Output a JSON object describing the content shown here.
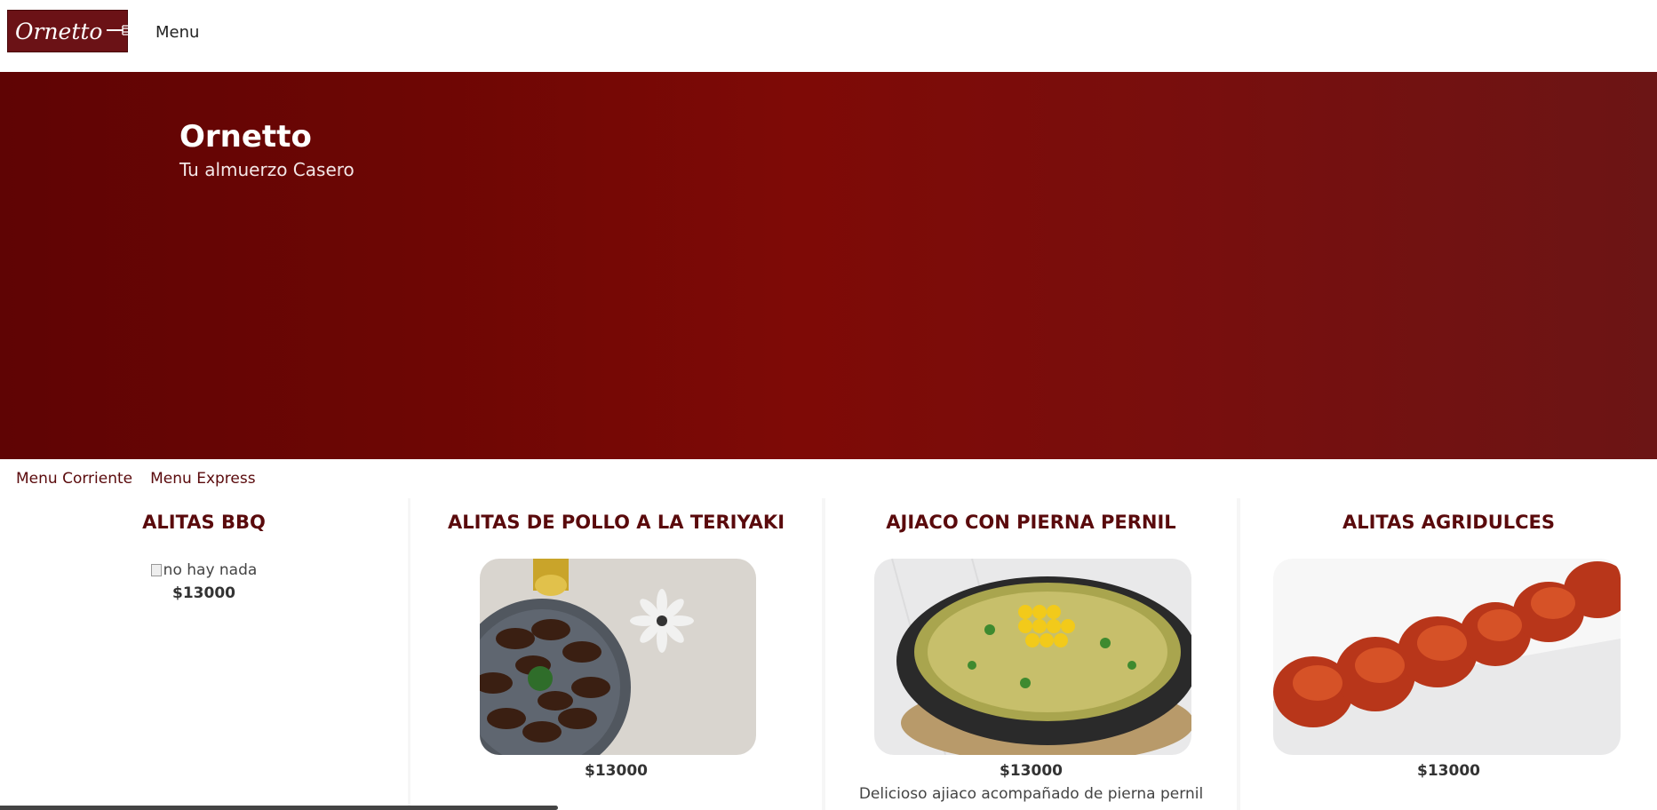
{
  "brand": {
    "logo_text": "Ornetto",
    "logo_color": "#6b1216"
  },
  "nav": {
    "menu_label": "Menu"
  },
  "hero": {
    "title": "Ornetto",
    "subtitle": "Tu almuerzo Casero"
  },
  "tabs": [
    {
      "label": "Menu Corriente"
    },
    {
      "label": "Menu Express"
    }
  ],
  "cards": [
    {
      "title": "ALITAS BBQ",
      "image_alt": "no hay nada",
      "price": "$13000",
      "description": ""
    },
    {
      "title": "ALITAS DE POLLO A LA TERIYAKI",
      "image": "teriyaki-wings-plate",
      "price": "$13000",
      "description": ""
    },
    {
      "title": "AJIACO CON PIERNA PERNIL",
      "image": "ajiaco-soup-bowl",
      "price": "$13000",
      "description": "Delicioso ajiaco acompañado de pierna pernil"
    },
    {
      "title": "ALITAS AGRIDULCES",
      "image": "sweet-sour-wings-plate",
      "price": "$13000",
      "description": ""
    }
  ],
  "colors": {
    "accent": "#5a0a0c",
    "hero_start": "#5f0404",
    "hero_mid": "#7e0a06",
    "hero_end": "#6c1515"
  }
}
